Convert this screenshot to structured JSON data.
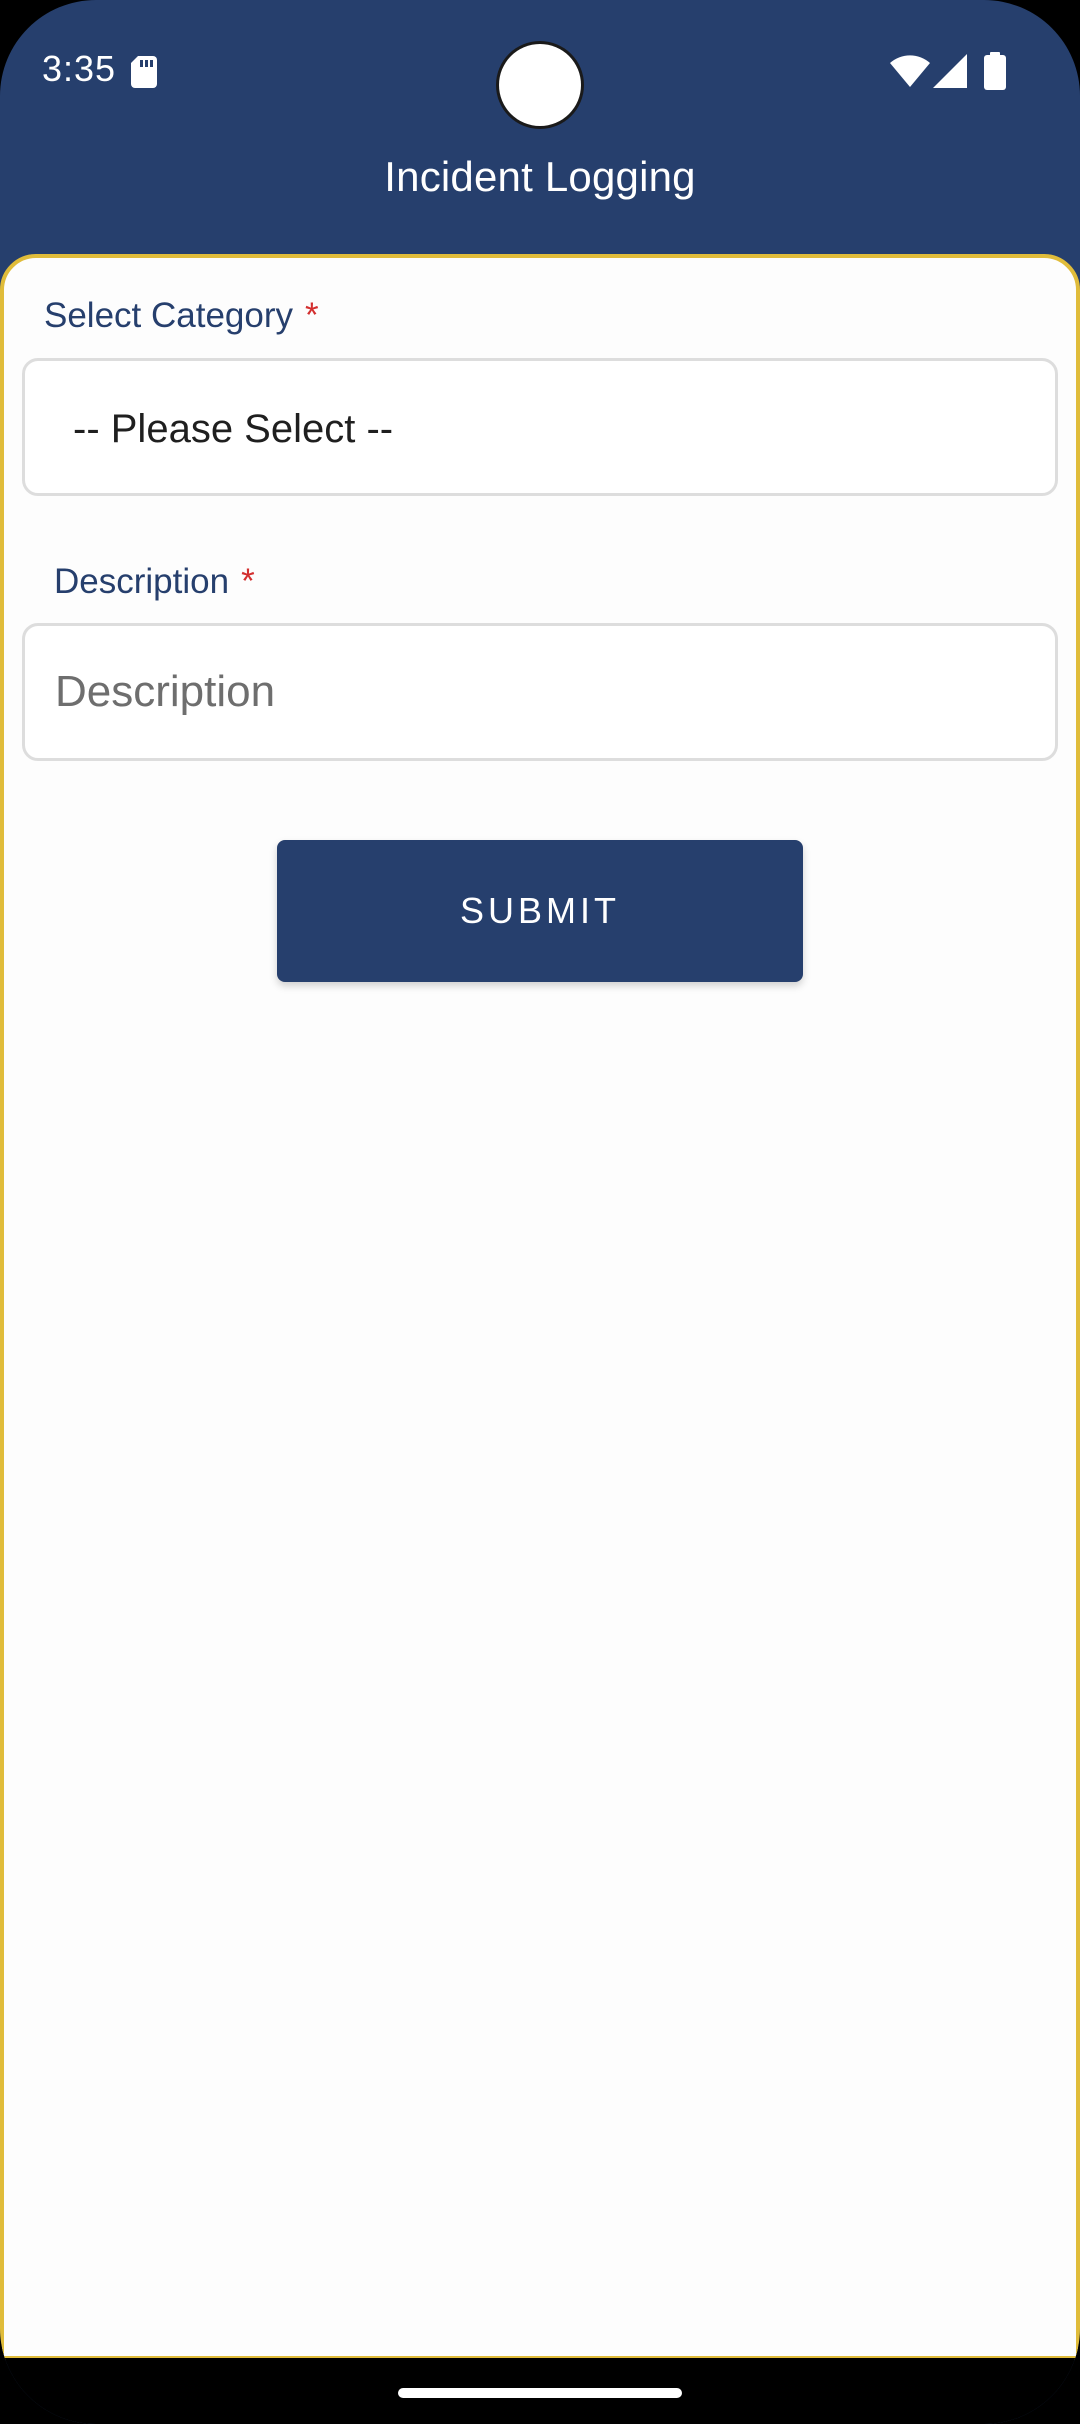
{
  "status_bar": {
    "time": "3:35"
  },
  "app_bar": {
    "title": "Incident Logging"
  },
  "form": {
    "category": {
      "label": "Select Category",
      "required_mark": "*",
      "selected_value": "-- Please Select --"
    },
    "description": {
      "label": "Description",
      "required_mark": "*",
      "placeholder": "Description",
      "value": ""
    },
    "submit_label": "SUBMIT"
  },
  "colors": {
    "primary": "#263f6d",
    "accent_border": "#e0bc3a",
    "required": "#d32f2f",
    "background": "#fdfdfd"
  },
  "icons": [
    "sd-card-icon",
    "wifi-icon",
    "signal-icon",
    "battery-icon"
  ]
}
